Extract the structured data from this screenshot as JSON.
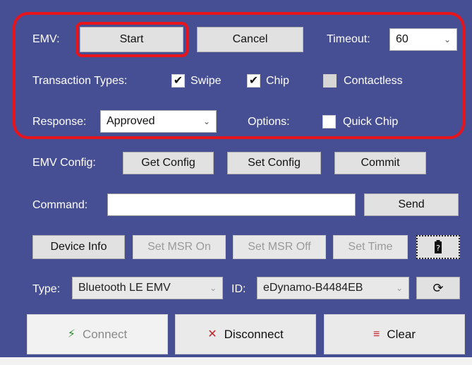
{
  "emv": {
    "label": "EMV:",
    "start": "Start",
    "cancel": "Cancel",
    "timeout_label": "Timeout:",
    "timeout_value": "60"
  },
  "transaction_types": {
    "label": "Transaction Types:",
    "swipe": {
      "label": "Swipe",
      "checked": true
    },
    "chip": {
      "label": "Chip",
      "checked": true
    },
    "contactless": {
      "label": "Contactless",
      "checked": false
    }
  },
  "response": {
    "label": "Response:",
    "value": "Approved"
  },
  "options": {
    "label": "Options:",
    "quick_chip": {
      "label": "Quick Chip",
      "checked": false
    }
  },
  "emv_config": {
    "label": "EMV Config:",
    "get": "Get Config",
    "set": "Set Config",
    "commit": "Commit"
  },
  "command": {
    "label": "Command:",
    "value": "",
    "send": "Send"
  },
  "device": {
    "info": "Device Info",
    "msr_on": "Set MSR On",
    "msr_off": "Set MSR Off",
    "set_time": "Set Time",
    "battery_icon": "battery-question-icon"
  },
  "connection": {
    "type_label": "Type:",
    "type_value": "Bluetooth LE EMV",
    "id_label": "ID:",
    "id_value": "eDynamo-B4484EB",
    "refresh_icon": "refresh-icon"
  },
  "actions": {
    "connect": "Connect",
    "disconnect": "Disconnect",
    "clear": "Clear"
  },
  "colors": {
    "panel": "#474f94",
    "highlight": "#e8141c"
  },
  "checkmark": "✔"
}
